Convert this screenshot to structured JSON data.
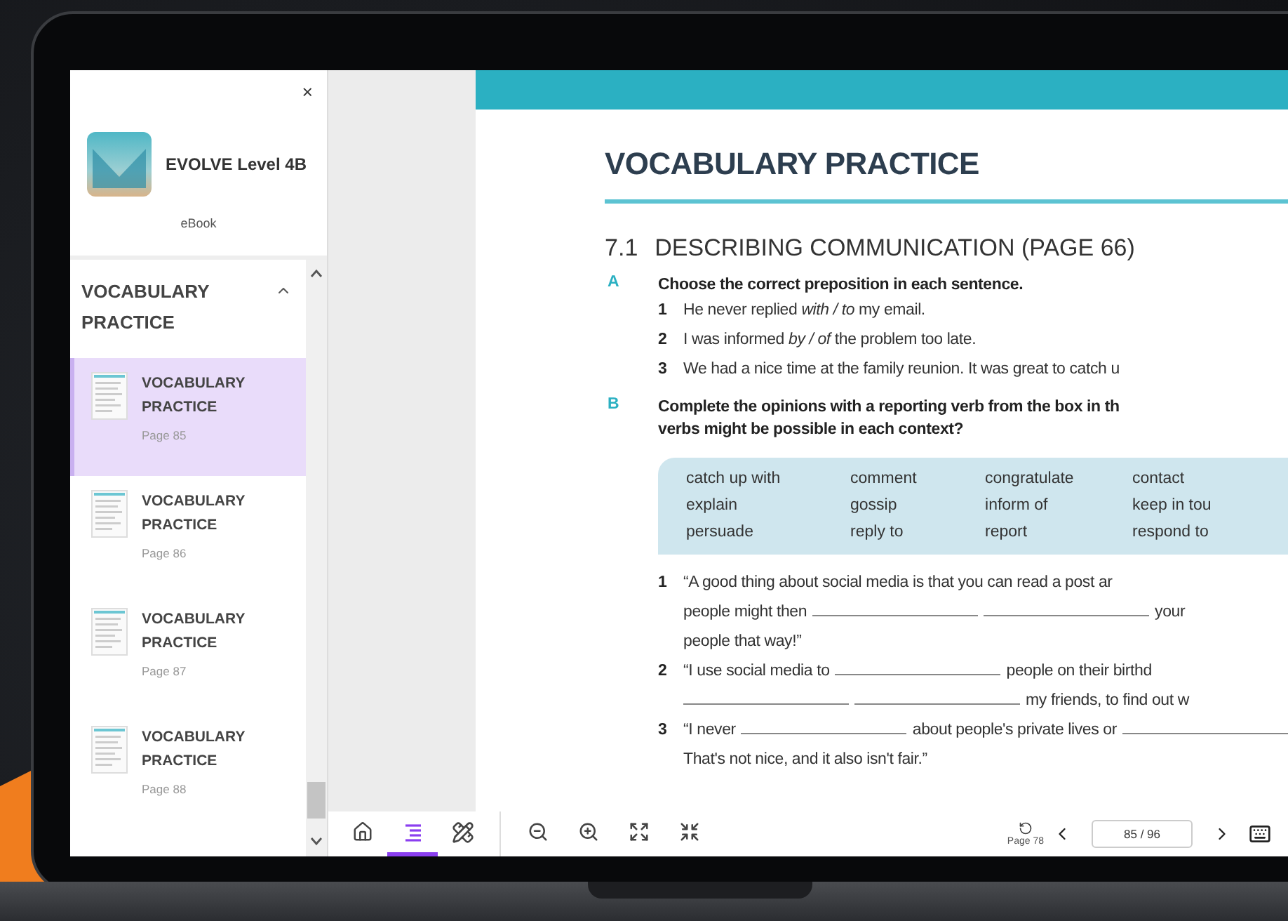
{
  "sidebar": {
    "close": "×",
    "book_title": "EVOLVE Level 4B",
    "subtitle": "eBook",
    "section": {
      "title": "VOCABULARY PRACTICE",
      "expanded": true
    },
    "items": [
      {
        "title": "VOCABULARY PRACTICE",
        "page": "Page 85",
        "selected": true
      },
      {
        "title": "VOCABULARY PRACTICE",
        "page": "Page 86",
        "selected": false
      },
      {
        "title": "VOCABULARY PRACTICE",
        "page": "Page 87",
        "selected": false
      },
      {
        "title": "VOCABULARY PRACTICE",
        "page": "Page 88",
        "selected": false
      }
    ]
  },
  "page": {
    "heading": "VOCABULARY PRACTICE",
    "section_number": "7.1",
    "section_title": "DESCRIBING COMMUNICATION (PAGE 66)",
    "exercises": [
      {
        "letter": "A",
        "instruction_lines": [
          "Choose the correct preposition in each sentence."
        ],
        "items": [
          {
            "number": "1",
            "lines": [
              [
                {
                  "kind": "text",
                  "text": "He never replied *with / to* my email."
                }
              ]
            ]
          },
          {
            "number": "2",
            "lines": [
              [
                {
                  "kind": "text",
                  "text": "I was informed *by / of* the problem too late."
                }
              ]
            ]
          },
          {
            "number": "3",
            "lines": [
              [
                {
                  "kind": "text",
                  "text": "We had a nice time at the family reunion. It was great to catch u"
                }
              ]
            ]
          }
        ]
      },
      {
        "letter": "B",
        "instruction_lines": [
          "Complete the opinions with a reporting verb from the box in th",
          "verbs might be possible in each context?"
        ],
        "word_box": [
          [
            "catch up with",
            "comment",
            "congratulate",
            "contact"
          ],
          [
            "explain",
            "gossip",
            "inform of",
            "keep in tou"
          ],
          [
            "persuade",
            "reply to",
            "report",
            "respond to"
          ]
        ],
        "items": [
          {
            "number": "1",
            "lines": [
              [
                {
                  "kind": "text",
                  "text": "“A good thing about social media is that you can read a post ar"
                }
              ],
              [
                {
                  "kind": "text",
                  "text": "people might then"
                },
                {
                  "kind": "blank"
                },
                {
                  "kind": "blank"
                },
                {
                  "kind": "text",
                  "text": "your"
                }
              ],
              [
                {
                  "kind": "text",
                  "text": "people that way!”"
                }
              ]
            ]
          },
          {
            "number": "2",
            "lines": [
              [
                {
                  "kind": "text",
                  "text": "“I use social media to"
                },
                {
                  "kind": "blank"
                },
                {
                  "kind": "text",
                  "text": "people on their birthd"
                }
              ],
              [
                {
                  "kind": "blank"
                },
                {
                  "kind": "blank"
                },
                {
                  "kind": "text",
                  "text": "my friends, to find out w"
                }
              ]
            ]
          },
          {
            "number": "3",
            "lines": [
              [
                {
                  "kind": "text",
                  "text": "“I never"
                },
                {
                  "kind": "blank"
                },
                {
                  "kind": "text",
                  "text": "about people's private lives or"
                },
                {
                  "kind": "blank"
                }
              ],
              [
                {
                  "kind": "text",
                  "text": "That's not nice, and it also isn't fair.”"
                }
              ]
            ]
          }
        ]
      }
    ]
  },
  "toolbar": {
    "tools": [
      {
        "kind": "home",
        "selected": false
      },
      {
        "kind": "contents",
        "selected": true
      },
      {
        "kind": "tools",
        "selected": false
      }
    ],
    "view": [
      {
        "kind": "zoom-out"
      },
      {
        "kind": "zoom-in"
      },
      {
        "kind": "expand"
      },
      {
        "kind": "shrink"
      }
    ],
    "rotate_label": "Page 78",
    "page_field": "85 / 96"
  }
}
